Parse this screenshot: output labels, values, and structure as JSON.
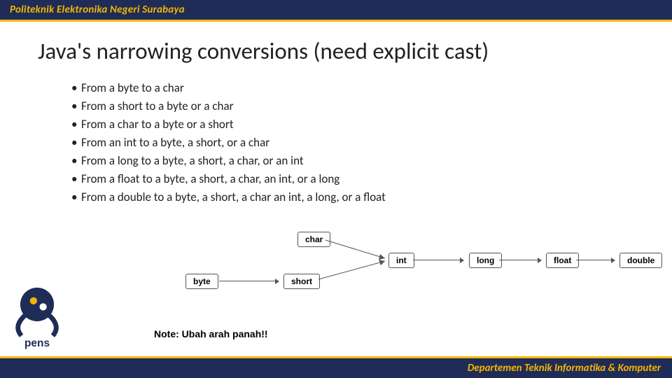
{
  "header": {
    "institution": "Politeknik Elektronika Negeri Surabaya"
  },
  "slide": {
    "title": "Java's narrowing conversions (need explicit cast)",
    "bullets": [
      "From a byte to a char",
      "From a short to a byte or a char",
      "From a char to a byte or a short",
      "From an int to a byte, a short, or a char",
      "From a long to a byte, a short, a char, or an int",
      "From a float to a byte, a short, a char, an int, or a long",
      "From a double to a byte, a short, a char an int, a long, or a float"
    ],
    "diagram": {
      "nodes": [
        "char",
        "byte",
        "short",
        "int",
        "long",
        "float",
        "double"
      ],
      "edges": [
        [
          "byte",
          "short"
        ],
        [
          "short",
          "int"
        ],
        [
          "char",
          "int"
        ],
        [
          "int",
          "long"
        ],
        [
          "long",
          "float"
        ],
        [
          "float",
          "double"
        ]
      ]
    },
    "note": "Note: Ubah arah panah!!"
  },
  "footer": {
    "department": "Departemen Teknik Informatika & Komputer"
  },
  "colors": {
    "brand_navy": "#1f2c57",
    "brand_gold": "#f2b600"
  }
}
